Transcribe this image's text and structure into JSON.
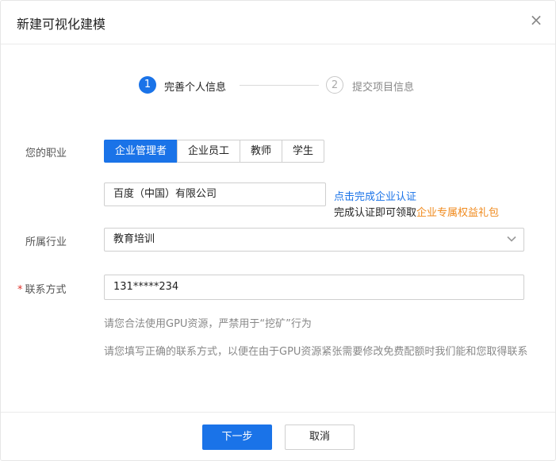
{
  "dialog": {
    "title": "新建可视化建模",
    "close_icon": "×"
  },
  "steps": [
    {
      "number": "1",
      "label": "完善个人信息",
      "state": "active"
    },
    {
      "number": "2",
      "label": "提交项目信息",
      "state": "inactive"
    }
  ],
  "form": {
    "occupation": {
      "label": "您的职业",
      "options": [
        "企业管理者",
        "企业员工",
        "教师",
        "学生"
      ],
      "selected": "企业管理者"
    },
    "company": {
      "value": "百度（中国）有限公司",
      "link_text": "点击完成企业认证",
      "promo_prefix": "完成认证即可领取",
      "promo_highlight": "企业专属权益礼包"
    },
    "industry": {
      "label": "所属行业",
      "value": "教育培训"
    },
    "contact": {
      "required_mark": "*",
      "label": "联系方式",
      "value": "131*****234"
    },
    "hints": [
      "请您合法使用GPU资源，严禁用于“挖矿”行为",
      "请您填写正确的联系方式，以便在由于GPU资源紧张需要修改免费配额时我们能和您取得联系"
    ]
  },
  "footer": {
    "next_label": "下一步",
    "cancel_label": "取消"
  },
  "colors": {
    "accent": "#1a73e8",
    "highlight": "#f08a1d",
    "required": "#e0322b"
  }
}
